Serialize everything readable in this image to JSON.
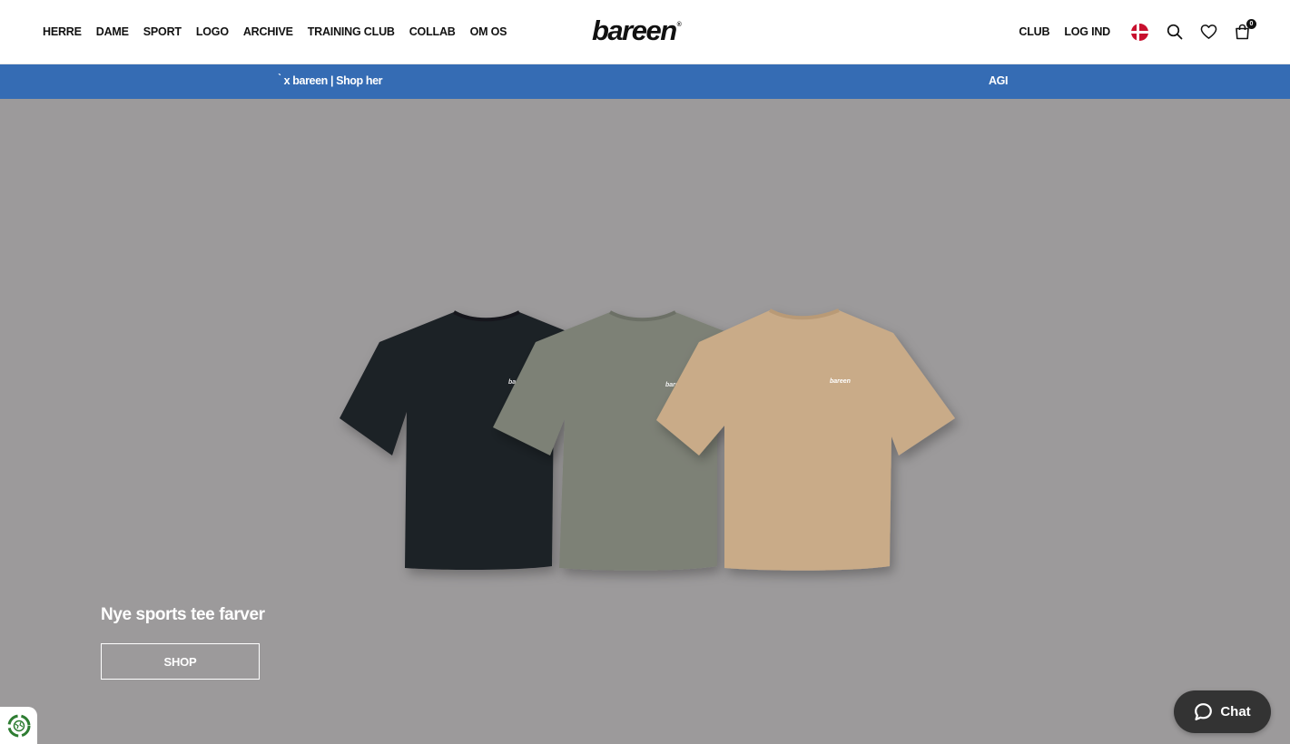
{
  "header": {
    "nav_left": [
      "HERRE",
      "DAME",
      "SPORT",
      "LOGO",
      "ARCHIVE",
      "TRAINING CLUB",
      "COLLAB",
      "OM OS"
    ],
    "logo": "bareen",
    "logo_mark": "®",
    "nav_right": {
      "club": "CLUB",
      "login": "LOG IND"
    },
    "icons": {
      "flag": "denmark-flag-icon",
      "search": "search-icon",
      "wishlist": "heart-icon",
      "cart": "shopping-bag-icon"
    },
    "cart_count": "0"
  },
  "announcement": {
    "segment_1": "̀ x bareen | Shop her",
    "segment_2": "AGI"
  },
  "hero": {
    "title": "Nye sports tee farver",
    "button": "SHOP",
    "tee_brand_print": "bareen"
  },
  "chat": {
    "label": "Chat",
    "icon": "chat-bubble-icon"
  },
  "colors": {
    "announcement_bg": "#356cb4",
    "hero_bg": "#9c9a9b",
    "tee_black": "#1e2127",
    "tee_green": "#7d8176",
    "tee_beige": "#c9ab88",
    "chat_bg": "#333333"
  }
}
